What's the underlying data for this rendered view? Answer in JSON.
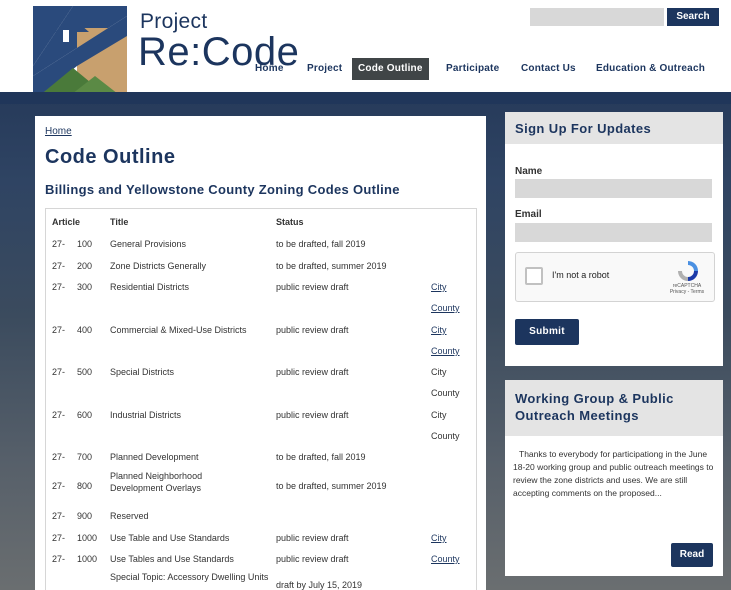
{
  "header": {
    "brand_small": "Project",
    "brand_big": "Re:Code",
    "search_placeholder": "",
    "search_label": "Search"
  },
  "nav": {
    "items": [
      {
        "label": "Home",
        "active": false
      },
      {
        "label": "Project",
        "active": false
      },
      {
        "label": "Code Outline",
        "active": true
      },
      {
        "label": "Participate",
        "active": false
      },
      {
        "label": "Contact Us",
        "active": false
      },
      {
        "label": "Education & Outreach",
        "active": false
      }
    ]
  },
  "main": {
    "breadcrumb": "Home",
    "title": "Code Outline",
    "subtitle": "Billings and Yellowstone County Zoning Codes Outline",
    "columns": [
      "Article",
      "Title",
      "Status"
    ],
    "rows": [
      {
        "prefix": "27-",
        "num": "100",
        "title": "General Provisions",
        "status": "to be drafted, fall 2019",
        "links": []
      },
      {
        "prefix": "27-",
        "num": "200",
        "title": "Zone Districts Generally",
        "status": "to be drafted, summer 2019",
        "links": []
      },
      {
        "prefix": "27-",
        "num": "300",
        "title": "Residential Districts",
        "status": "public review draft",
        "links": [
          {
            "text": "City",
            "linked": true
          },
          {
            "text": "County",
            "linked": true
          }
        ]
      },
      {
        "prefix": "27-",
        "num": "400",
        "title": "Commercial & Mixed-Use Districts",
        "status": "public review draft",
        "links": [
          {
            "text": "City",
            "linked": true
          },
          {
            "text": "County",
            "linked": true
          }
        ]
      },
      {
        "prefix": "27-",
        "num": "500",
        "title": "Special Districts",
        "status": "public review draft",
        "links": [
          {
            "text": "City",
            "linked": false
          },
          {
            "text": "County",
            "linked": false
          }
        ]
      },
      {
        "prefix": "27-",
        "num": "600",
        "title": "Industrial Districts",
        "status": "public review draft",
        "links": [
          {
            "text": "City",
            "linked": false
          },
          {
            "text": "County",
            "linked": false
          }
        ]
      },
      {
        "prefix": "27-",
        "num": "700",
        "title": "Planned Development",
        "status": "to be drafted, fall 2019",
        "links": []
      },
      {
        "prefix": "27-",
        "num": "800",
        "title": "Planned Neighborhood Development Overlays",
        "status": "to be drafted, summer 2019",
        "links": []
      },
      {
        "prefix": "27-",
        "num": "900",
        "title": "Reserved",
        "status": "",
        "links": []
      },
      {
        "prefix": "27-",
        "num": "1000",
        "title": "Use Table and Use Standards",
        "status": "public review draft",
        "links": [
          {
            "text": "City",
            "linked": true
          }
        ]
      },
      {
        "prefix": "27-",
        "num": "1000",
        "title": "Use Tables and Use Standards",
        "status": "public review draft",
        "links": [
          {
            "text": "County",
            "linked": true
          }
        ]
      },
      {
        "prefix": "",
        "num": "",
        "title": "Special Topic: Accessory Dwelling Units",
        "status": "draft by July 15, 2019",
        "links": []
      }
    ]
  },
  "signup": {
    "title": "Sign Up For Updates",
    "name_label": "Name",
    "email_label": "Email",
    "captcha_label": "I'm not a robot",
    "captcha_brand": "reCAPTCHA",
    "captcha_terms": "Privacy - Terms",
    "submit_label": "Submit"
  },
  "news": {
    "title": "Working Group & Public Outreach Meetings",
    "body": "Thanks to everybody for participationg in the June 18-20 working group and public outreach meetings to review the zone districts and uses.  We are still accepting comments on the proposed...",
    "read_label": "Read"
  },
  "colors": {
    "brand_navy": "#1c355e",
    "nav_active_bg": "#404547",
    "panel_head_bg": "#e4e4e4",
    "logo_blue": "#2a4a7c",
    "logo_green": "#4a7a3a",
    "logo_tan": "#c8a06e"
  }
}
